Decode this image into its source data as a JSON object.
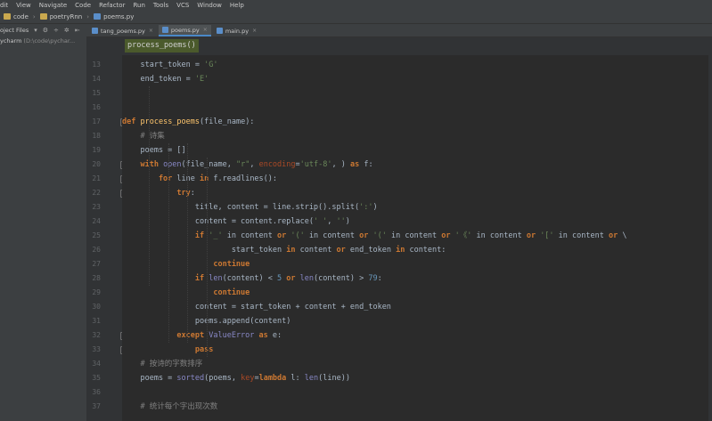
{
  "menu": [
    "dit",
    "View",
    "Navigate",
    "Code",
    "Refactor",
    "Run",
    "Tools",
    "VCS",
    "Window",
    "Help"
  ],
  "breadcrumb": [
    "code",
    "poetryRnn",
    "poems.py"
  ],
  "sidebar": {
    "tool_label": "oject Files",
    "project_name": "ycharm",
    "project_path": "(D:\\code\\pychar..."
  },
  "tabs": [
    {
      "label": "tang_poems.py",
      "active": false
    },
    {
      "label": "poems.py",
      "active": true
    },
    {
      "label": "main.py",
      "active": false
    }
  ],
  "func_chip": "process_poems()",
  "lines": [
    {
      "num": "13",
      "html": "<span>    start_token = </span><span class='str'>'G'</span>"
    },
    {
      "num": "14",
      "html": "<span>    end_token = </span><span class='str'>'E'</span>"
    },
    {
      "num": "15",
      "html": ""
    },
    {
      "num": "16",
      "html": ""
    },
    {
      "num": "17",
      "html": "<span class='kw'>def </span><span class='fn'>process_poems</span><span>(file_name):</span>"
    },
    {
      "num": "18",
      "html": "<span class='cm'>    # 诗集</span>"
    },
    {
      "num": "19",
      "html": "<span>    poems = []</span>"
    },
    {
      "num": "20",
      "html": "<span class='kw'>    with </span><span class='bi'>open</span><span>(file_name, </span><span class='str'>\"r\"</span><span>, </span><span class='pm'>encoding</span><span>=</span><span class='str'>'utf-8'</span><span>, ) </span><span class='kw'>as </span><span>f:</span>"
    },
    {
      "num": "21",
      "html": "<span class='kw'>        for </span><span>line </span><span class='kw'>in </span><span>f.readlines():</span>"
    },
    {
      "num": "22",
      "html": "<span class='kw'>            try</span><span>:</span>"
    },
    {
      "num": "23",
      "html": "<span>                title, content = line.strip().split(</span><span class='str'>':'</span><span>)</span>"
    },
    {
      "num": "24",
      "html": "<span>                content = content.replace(</span><span class='str'>' '</span><span>, </span><span class='str'>''</span><span>)</span>"
    },
    {
      "num": "25",
      "html": "<span class='kw'>                if </span><span class='str'>'_'</span><span> in content </span><span class='kw'>or </span><span class='str'>'('</span><span> in content </span><span class='kw'>or </span><span class='str'>'('</span><span> in content </span><span class='kw'>or </span><span class='str'>'《'</span><span> in content </span><span class='kw'>or </span><span class='str'>'['</span><span> in content </span><span class='kw'>or </span><span>\\</span>"
    },
    {
      "num": "26",
      "html": "<span>                        start_token </span><span class='kw'>in </span><span>content </span><span class='kw'>or </span><span>end_token </span><span class='kw'>in </span><span>content:</span>"
    },
    {
      "num": "27",
      "html": "<span class='kw'>                    continue</span>"
    },
    {
      "num": "28",
      "html": "<span class='kw'>                if </span><span class='bi'>len</span><span>(content) &lt; </span><span class='num'>5</span><span class='kw'> or </span><span class='bi'>len</span><span>(content) &gt; </span><span class='num'>79</span><span>:</span>"
    },
    {
      "num": "29",
      "html": "<span class='kw'>                    continue</span>"
    },
    {
      "num": "30",
      "html": "<span>                content = start_token + content + end_token</span>"
    },
    {
      "num": "31",
      "html": "<span>                poems.append(content)</span>"
    },
    {
      "num": "32",
      "html": "<span class='kw'>            except </span><span class='bi'>ValueError </span><span class='kw'>as </span><span>e:</span>"
    },
    {
      "num": "33",
      "html": "<span class='kw'>                pass</span>"
    },
    {
      "num": "34",
      "html": "<span class='cm'>    # 按诗的字数排序</span>"
    },
    {
      "num": "35",
      "html": "<span>    poems = </span><span class='bi'>sorted</span><span>(poems, </span><span class='pm'>key</span><span>=</span><span class='kw'>lambda </span><span>l: </span><span class='bi'>len</span><span>(line))</span>"
    },
    {
      "num": "36",
      "html": ""
    },
    {
      "num": "37",
      "html": "<span class='cm'>    # 统计每个字出现次数</span>"
    }
  ],
  "colors": {
    "editor_bg": "#2b2b2b",
    "gutter_bg": "#313335",
    "chrome_bg": "#3c3f41",
    "keyword": "#cc7832",
    "string": "#6a8759",
    "number": "#6897bb",
    "comment": "#808080",
    "builtin": "#8888c6",
    "function": "#ffc66d",
    "active_tab_underline": "#4a88c7"
  }
}
